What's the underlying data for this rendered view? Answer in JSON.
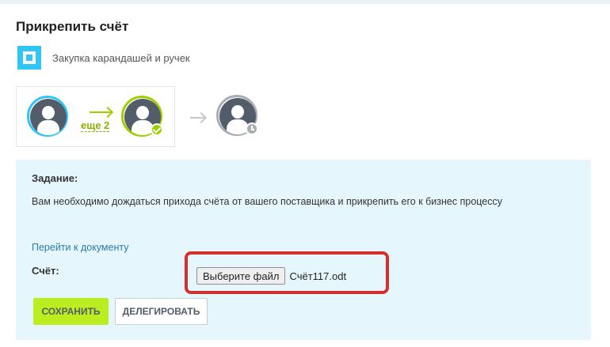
{
  "page": {
    "title": "Прикрепить счёт"
  },
  "process": {
    "name": "Закупка карандашей и ручек",
    "icon": "process-square-icon",
    "accent_color": "#2fc6f6"
  },
  "flow": {
    "more_label": "еще 2",
    "participants": [
      {
        "role": "author",
        "status": "active",
        "icon": "user-avatar-icon",
        "ring_color": "#2fc6f6"
      },
      {
        "role": "completed",
        "status": "done",
        "icon": "user-avatar-icon",
        "badge_icon": "check-icon",
        "ring_color": "#9dcf00"
      },
      {
        "role": "current",
        "status": "waiting",
        "icon": "user-avatar-icon",
        "badge_icon": "clock-icon",
        "ring_color": "#a8adb4"
      }
    ]
  },
  "task": {
    "heading": "Задание:",
    "description": "Вам необходимо дождаться прихода счёта от вашего поставщика и прикрепить его к бизнес процессу",
    "document_link": "Перейти к документу",
    "invoice_label": "Счёт:",
    "file_button_label": "Выберите файл",
    "file_name": "Счёт117.odt",
    "highlight_color": "#d32f2f",
    "panel_color": "#e5f7fd"
  },
  "actions": {
    "save_label": "Сохранить",
    "delegate_label": "Делегировать",
    "save_color": "#bbed21"
  }
}
